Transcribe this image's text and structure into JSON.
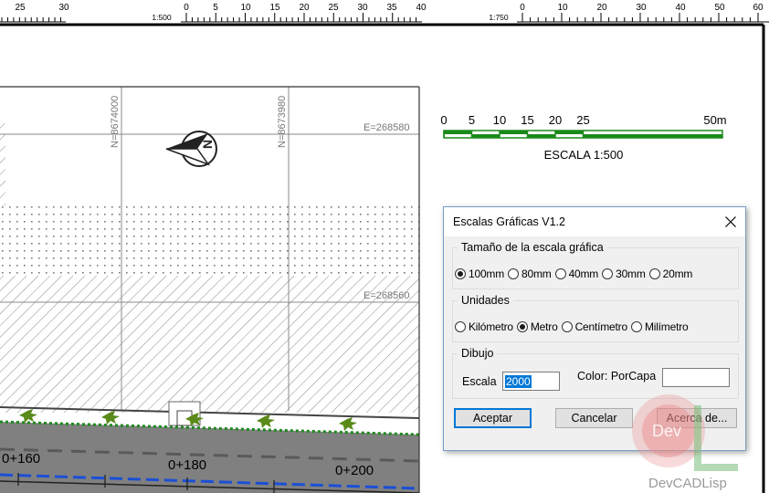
{
  "top_ruler_left": {
    "labels": [
      "25",
      "30",
      "0",
      "5",
      "10",
      "15",
      "20",
      "25",
      "30",
      "35",
      "40"
    ],
    "scale_label": "1:500"
  },
  "top_ruler_right": {
    "labels": [
      "0",
      "10",
      "20",
      "30",
      "40",
      "50",
      "60"
    ],
    "scale_label": "1:750"
  },
  "drawing": {
    "northing_1": "N=8674000",
    "northing_2": "N=8673980",
    "easting_1": "E=268580",
    "easting_2": "E=268560",
    "station_1": "0+160",
    "station_2": "0+180",
    "station_3": "0+200",
    "north_arrow_letter": "N",
    "colors": {
      "green_line": "#1f8a1f",
      "blue_line": "#1a4fd6",
      "road": "#7a7a7a",
      "hatch": "#888888"
    }
  },
  "scale_bar": {
    "ticks": [
      "0",
      "5",
      "10",
      "15",
      "20",
      "25"
    ],
    "end_label": "50m",
    "caption": "ESCALA 1:500",
    "color": "#1a8a1a"
  },
  "dialog": {
    "title": "Escalas Gráficas V1.2",
    "size_group": {
      "legend": "Tamaño de la escala gráfica",
      "options": [
        "100mm",
        "80mm",
        "40mm",
        "30mm",
        "20mm"
      ],
      "selected": "100mm"
    },
    "units_group": {
      "legend": "Unidades",
      "options": [
        "Kilómetro",
        "Metro",
        "Centímetro",
        "Milímetro"
      ],
      "selected": "Metro"
    },
    "drawing_group": {
      "legend": "Dibujo",
      "scale_label": "Escala",
      "scale_value": "2000",
      "color_label": "Color: PorCapa"
    },
    "buttons": {
      "accept": "Aceptar",
      "cancel": "Cancelar",
      "about": "Acerca de..."
    }
  },
  "watermark": {
    "logo_text": "Dev",
    "caption": "DevCADLisp"
  }
}
